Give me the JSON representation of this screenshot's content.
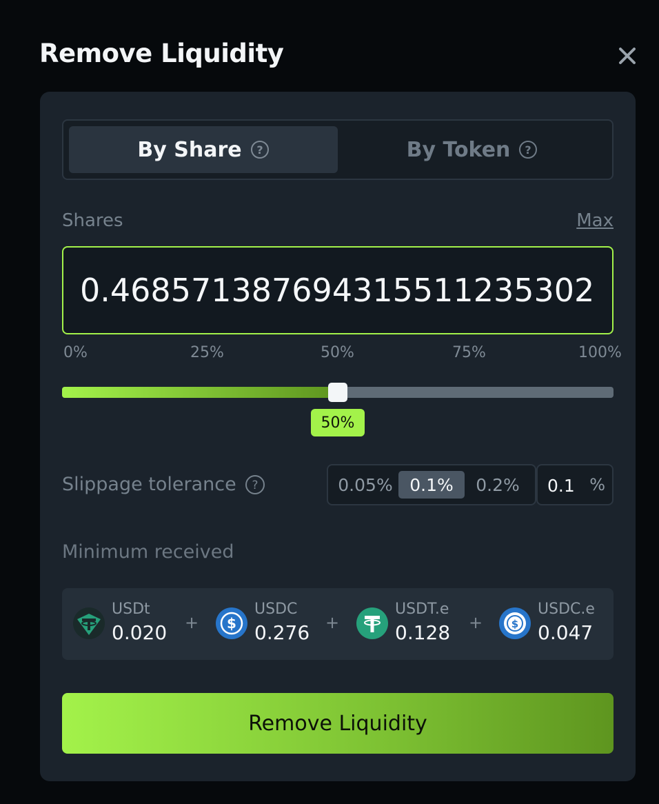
{
  "modal": {
    "title": "Remove Liquidity",
    "close_icon": "close-icon"
  },
  "tabs": [
    {
      "label": "By Share",
      "active": true,
      "icon": "help-circle-icon"
    },
    {
      "label": "By Token",
      "active": false,
      "icon": "help-circle-icon"
    }
  ],
  "shares": {
    "label": "Shares",
    "max_label": "Max",
    "value": "0.468571387694315511235302"
  },
  "slider": {
    "ticks": [
      "0%",
      "25%",
      "50%",
      "75%",
      "100%"
    ],
    "value_percent": 50,
    "tooltip": "50%",
    "colors": {
      "fill_start": "#a3f24a",
      "fill_end": "#5e951f",
      "track": "#5f6b76"
    }
  },
  "slippage": {
    "label": "Slippage tolerance",
    "icon": "help-circle-icon",
    "options": [
      "0.05%",
      "0.1%",
      "0.2%"
    ],
    "selected": "0.1%",
    "custom_value": "0.1",
    "custom_unit": "%"
  },
  "minimum_received": {
    "label": "Minimum received",
    "separator": "+",
    "tokens": [
      {
        "symbol": "USDt",
        "amount": "0.020",
        "icon": "usdt-tether-icon"
      },
      {
        "symbol": "USDC",
        "amount": "0.276",
        "icon": "usdc-icon"
      },
      {
        "symbol": "USDT.e",
        "amount": "0.128",
        "icon": "usdt-tether-icon"
      },
      {
        "symbol": "USDC.e",
        "amount": "0.047",
        "icon": "usdc-icon"
      }
    ]
  },
  "action": {
    "label": "Remove Liquidity",
    "accent": "#a3f24a"
  }
}
